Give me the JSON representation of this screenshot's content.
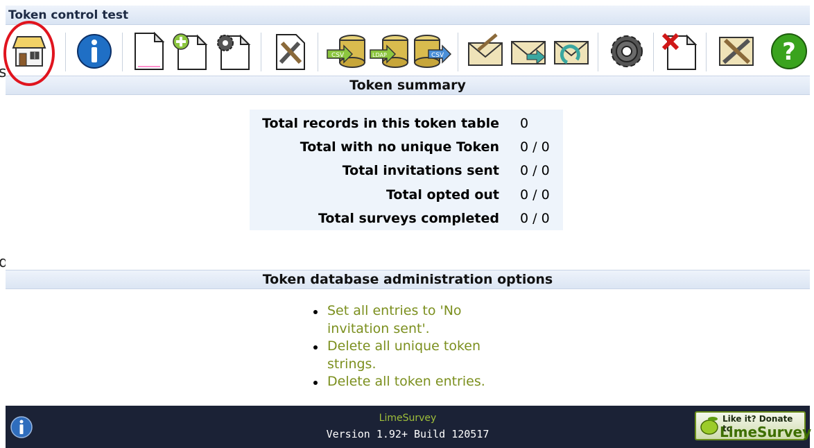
{
  "edge_fragments": [
    "s",
    "d"
  ],
  "window": {
    "title": "Token control test"
  },
  "toolbar": {
    "icons": [
      "home-icon",
      "info-icon",
      "page-icon",
      "page-add-icon",
      "page-settings-icon",
      "tools-icon",
      "csv-import-icon",
      "ldap-import-icon",
      "csv-export-icon",
      "invite-icon",
      "send-reminder-icon",
      "bounce-icon",
      "gear-icon",
      "delete-page-icon",
      "admin-tools-icon",
      "help-icon"
    ]
  },
  "summary": {
    "heading": "Token summary",
    "rows": [
      {
        "label": "Total records in this token table",
        "value": "0"
      },
      {
        "label": "Total with no unique Token",
        "value": "0 / 0"
      },
      {
        "label": "Total invitations sent",
        "value": "0 / 0"
      },
      {
        "label": "Total opted out",
        "value": "0 / 0"
      },
      {
        "label": "Total surveys completed",
        "value": "0 / 0"
      }
    ]
  },
  "admin": {
    "heading": "Token database administration options",
    "options": [
      "Set all entries to 'No invitation sent'.",
      "Delete all unique token strings.",
      "Delete all token entries."
    ]
  },
  "footer": {
    "brand": "LimeSurvey",
    "version": "Version 1.92+ Build 120517",
    "donate_small": "Like it? Donate to",
    "donate_big": "LimeSurvey"
  },
  "colors": {
    "link": "#7b8f1e",
    "footer_bg": "#1b2236",
    "highlight": "#e0141e"
  }
}
